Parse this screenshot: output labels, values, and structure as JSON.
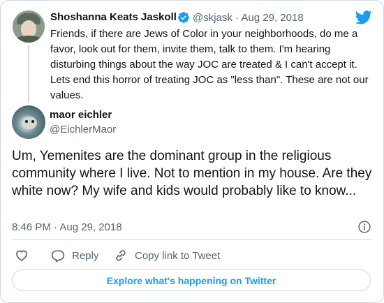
{
  "parent": {
    "name": "Shoshanna Keats Jaskoll",
    "handle": "@skjask",
    "separator": "·",
    "date": "Aug 29, 2018",
    "text": "Friends, if there are Jews of Color in your neighborhoods, do me a favor, look out for them, invite them, talk to them. I'm hearing disturbing things about the way JOC are treated & I can't accept it. Lets end this horror of treating JOC as \"less than\". These are not our values."
  },
  "reply": {
    "name": "maor eichler",
    "handle": "@EichlerMaor",
    "text": "Um, Yemenites are the dominant group in the religious community where I live. Not to mention in my house. Are they white now? My wife and kids would probably like to know...",
    "timestamp": "8:46 PM · Aug 29, 2018"
  },
  "actions": {
    "reply_label": "Reply",
    "copy_label": "Copy link to Tweet"
  },
  "explore_label": "Explore what's happening on Twitter",
  "colors": {
    "brand": "#1d9bf0",
    "text": "#0f1419",
    "muted": "#536471",
    "border": "#cfd9de"
  },
  "icons": [
    "verified-badge-icon",
    "twitter-bird-icon",
    "info-icon",
    "heart-icon",
    "reply-icon",
    "link-icon"
  ]
}
